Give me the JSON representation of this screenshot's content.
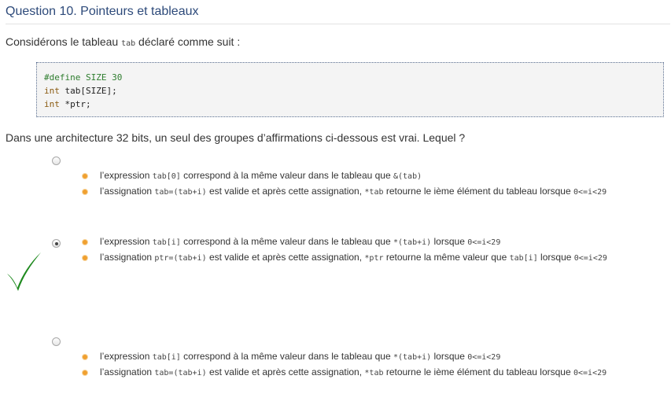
{
  "question": {
    "title": "Question 10. Pointeurs et tableaux",
    "intro_prefix": "Considérons le tableau ",
    "intro_code": "tab",
    "intro_suffix": " déclaré comme suit :",
    "code_lines": {
      "l1_kw": "#define",
      "l1_rest": " SIZE 30",
      "l2_kw": "int",
      "l2_rest": " tab[SIZE];",
      "l3_kw": "int",
      "l3_rest": " *ptr;"
    },
    "prompt": "Dans une architecture 32 bits, un seul des groupes d’affirmations ci-dessous est vrai. Lequel ?"
  },
  "options": [
    {
      "selected": false,
      "items": [
        {
          "t1": "l’expression ",
          "c1": "tab[0]",
          "t2": " correspond à la même valeur dans le tableau que ",
          "c2": "&(tab)"
        },
        {
          "t1": "l’assignation ",
          "c1": "tab=(tab+i)",
          "t2": " est valide et après cette assignation, ",
          "c2": "*tab",
          "t3": " retourne le ième élément du tableau lorsque ",
          "c3": "0<=i<29"
        }
      ]
    },
    {
      "selected": true,
      "items": [
        {
          "t1": "l’expression ",
          "c1": "tab[i]",
          "t2": " correspond à la même valeur dans le tableau que ",
          "c2": "*(tab+i)",
          "t3": " lorsque ",
          "c3": "0<=i<29"
        },
        {
          "t1": "l’assignation ",
          "c1": "ptr=(tab+i)",
          "t2": " est valide et après cette assignation, ",
          "c2": "*ptr",
          "t3": " retourne la même valeur que ",
          "c3": "tab[i]",
          "t4": " lorsque ",
          "c4": "0<=i<29"
        }
      ]
    },
    {
      "selected": false,
      "items": [
        {
          "t1": "l’expression ",
          "c1": "tab[i]",
          "t2": " correspond à la même valeur dans le tableau que ",
          "c2": "*(tab+i)",
          "t3": " lorsque ",
          "c3": "0<=i<29"
        },
        {
          "t1": "l’assignation ",
          "c1": "tab=(tab+i)",
          "t2": " est valide et après cette assignation, ",
          "c2": "*tab",
          "t3": " retourne le ième élément du tableau lorsque ",
          "c3": "0<=i<29"
        }
      ]
    }
  ],
  "colors": {
    "title": "#2d4a7a",
    "bullet": "#f0a030",
    "checkmark": "#1f8a1f",
    "code_preprocessor": "#2e7d2e",
    "code_type": "#8a5a10"
  },
  "icons": {
    "correct_answer": "check-icon",
    "bullet": "orange-bullet-icon"
  }
}
